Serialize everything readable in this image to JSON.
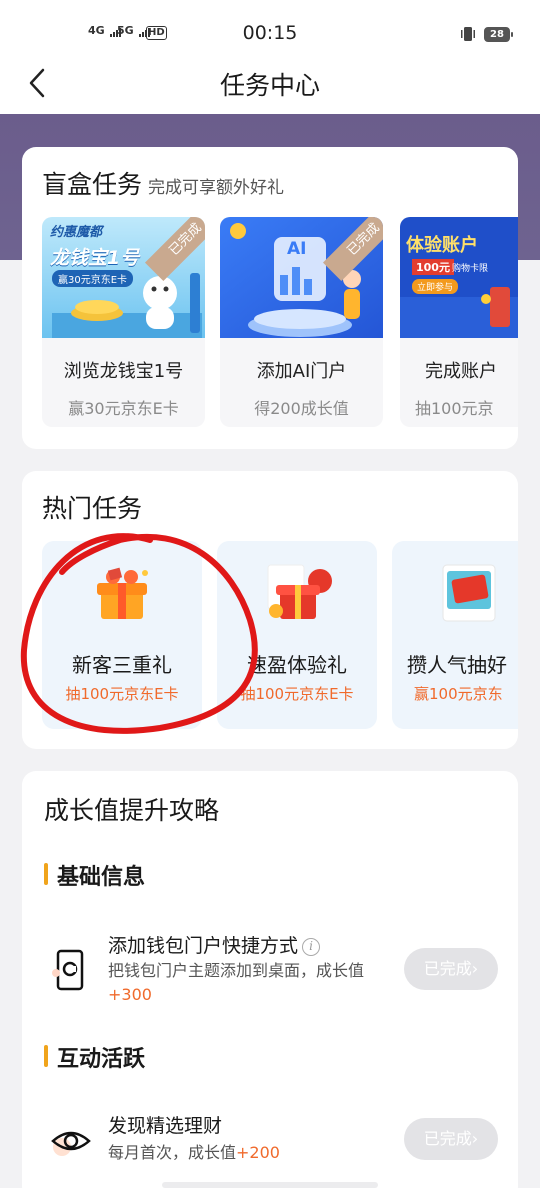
{
  "status_bar": {
    "net1": "4G",
    "net2": "5G",
    "hd": "HD",
    "time": "00:15",
    "battery": "28"
  },
  "nav": {
    "title": "任务中心"
  },
  "blind_box": {
    "title": "盲盒任务",
    "subtitle": "完成可享额外好礼",
    "items": [
      {
        "name": "浏览龙钱宝1号",
        "reward": "赢30元京东E卡",
        "badge": "已完成",
        "img_text1": "约惠魔都",
        "img_text2": "龙钱宝1号",
        "img_text3": "赢30元京东E卡"
      },
      {
        "name": "添加AI门户",
        "reward": "得200成长值",
        "badge": "已完成",
        "img_text1": "AI"
      },
      {
        "name": "完成账户",
        "reward": "抽100元京",
        "img_text1": "体验账户",
        "img_text2": "100元",
        "img_text3": "购物卡限",
        "img_text4": "立即参与"
      }
    ]
  },
  "hot": {
    "title": "热门任务",
    "items": [
      {
        "name": "新客三重礼",
        "reward": "抽100元京东E卡"
      },
      {
        "name": "速盈体验礼",
        "reward": "抽100元京东E卡"
      },
      {
        "name": "攒人气抽好",
        "reward": "赢100元京东"
      }
    ]
  },
  "growth": {
    "title": "成长值提升攻略",
    "sections": [
      {
        "heading": "基础信息",
        "task": {
          "title": "添加钱包门户快捷方式",
          "desc": "把钱包门户主题添加到桌面，成长值",
          "plus": "+300",
          "button": "已完成›",
          "icon": "phone-shortcut-icon"
        }
      },
      {
        "heading": "互动活跃",
        "task": {
          "title": "发现精选理财",
          "desc": "每月首次，成长值",
          "plus": "+200",
          "button": "已完成›",
          "icon": "eye-icon"
        }
      }
    ]
  },
  "colors": {
    "banner": "#6b5d8c",
    "accent_orange": "#f06a2c",
    "section_bar": "#f0a41c",
    "hot_card_bg": "#eef5fc",
    "annotation_red": "#e01818"
  }
}
